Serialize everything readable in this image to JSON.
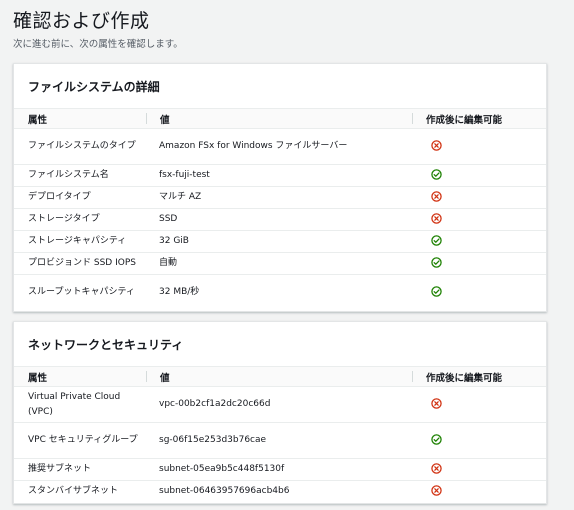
{
  "page": {
    "title": "確認および作成",
    "description": "次に進む前に、次の属性を確認します。"
  },
  "colors": {
    "no": "#d13212",
    "yes": "#1d8102"
  },
  "sections": [
    {
      "title": "ファイルシステムの詳細",
      "columns": [
        "属性",
        "値",
        "作成後に編集可能"
      ],
      "rows": [
        {
          "attribute": "ファイルシステムのタイプ",
          "value": "Amazon FSx for Windows ファイルサーバー",
          "editable": "no-icon"
        },
        {
          "attribute": "ファイルシステム名",
          "value": "fsx-fuji-test",
          "editable": "yes-icon"
        },
        {
          "attribute": "デプロイタイプ",
          "value": "マルチ AZ",
          "editable": "no-icon"
        },
        {
          "attribute": "ストレージタイプ",
          "value": "SSD",
          "editable": "no-icon"
        },
        {
          "attribute": "ストレージキャパシティ",
          "value": "32 GiB",
          "editable": "yes-icon"
        },
        {
          "attribute": "プロビジョンド SSD IOPS",
          "value": "自動",
          "editable": "yes-icon"
        },
        {
          "attribute": "スループットキャパシティ",
          "value": "32 MB/秒",
          "editable": "yes-icon"
        }
      ]
    },
    {
      "title": "ネットワークとセキュリティ",
      "columns": [
        "属性",
        "値",
        "作成後に編集可能"
      ],
      "rows": [
        {
          "attribute": "Virtual Private Cloud (VPC)",
          "value": "vpc-00b2cf1a2dc20c66d",
          "editable": "no-icon"
        },
        {
          "attribute": "VPC セキュリティグループ",
          "value": "sg-06f15e253d3b76cae",
          "editable": "yes-icon"
        },
        {
          "attribute": "推奨サブネット",
          "value": "subnet-05ea9b5c448f5130f",
          "editable": "no-icon"
        },
        {
          "attribute": "スタンバイサブネット",
          "value": "subnet-06463957696acb4b6",
          "editable": "no-icon"
        }
      ]
    }
  ]
}
